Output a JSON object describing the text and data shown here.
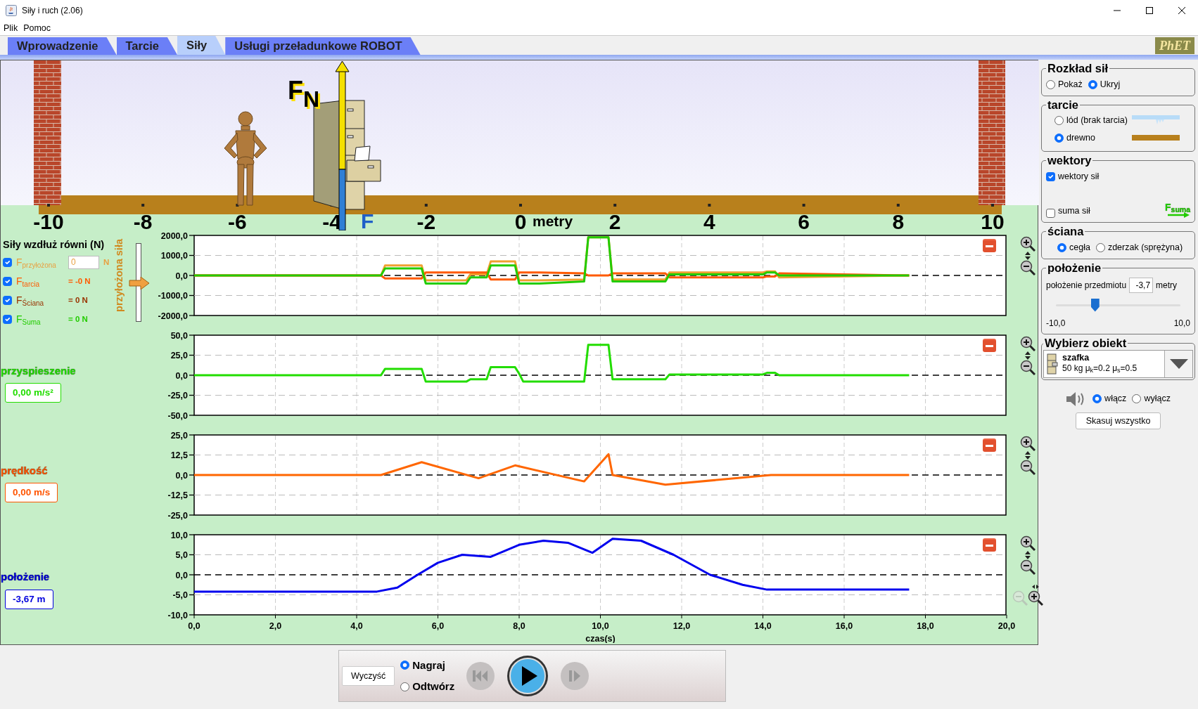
{
  "window": {
    "title": "Siły i ruch (2.06)"
  },
  "menu": [
    "Plik",
    "Pomoc"
  ],
  "tabs": [
    {
      "label": "Wprowadzenie",
      "selected": false
    },
    {
      "label": "Tarcie",
      "selected": false
    },
    {
      "label": "Siły",
      "selected": true
    },
    {
      "label": "Usługi przeładunkowe ROBOT",
      "selected": false
    }
  ],
  "logo": "PhET",
  "scene": {
    "ruler_labels": [
      "-10",
      "-8",
      "-6",
      "-4",
      "-2",
      "0",
      "2",
      "4",
      "6",
      "8",
      "10"
    ],
    "ruler_unit": "metry",
    "force_labels": [
      {
        "text": "F$_{N}$",
        "kind": "normal"
      },
      {
        "text": "F",
        "kind": "weight"
      }
    ]
  },
  "graphs": [
    {
      "kind": "forces",
      "title": "Siły wzdłuż równi (N)",
      "forces": [
        {
          "label": "F$_{przyłożona}$",
          "kind": "input",
          "value": "0",
          "unit": "N",
          "checked": true,
          "color": "#e8a040"
        },
        {
          "label": "F$_{tarcia}$",
          "kind": "reading",
          "reading": "= -0 N",
          "checked": true,
          "color": "#ff5a00"
        },
        {
          "label": "F$_{Ściana}$",
          "kind": "reading",
          "reading": "= 0 N",
          "checked": true,
          "color": "#993300"
        },
        {
          "label": "F$_{Suma}$",
          "kind": "reading",
          "reading": "= 0 N",
          "checked": true,
          "color": "#22cc00"
        }
      ],
      "slider": {
        "label": "przyłożona siła",
        "level": 0.5
      },
      "chart_data": {
        "type": "line",
        "x": [
          0,
          3.0,
          4.6,
          4.7,
          5.6,
          5.7,
          6.7,
          6.8,
          7.2,
          7.3,
          7.9,
          8.0,
          8.5,
          9.6,
          9.7,
          10.2,
          10.3,
          11.6,
          11.7,
          14.0,
          14.1,
          14.3,
          14.4,
          17.6
        ],
        "xlim": [
          0,
          20
        ],
        "ylim": [
          -2000,
          2000
        ],
        "grid": true,
        "ref_lines": [
          {
            "axis": "y",
            "value": 0
          }
        ],
        "yticks": [
          {
            "value": 2000,
            "label": "2000,0"
          },
          {
            "value": 1000,
            "label": "1000,0"
          },
          {
            "value": 0,
            "label": "0,0"
          },
          {
            "value": -1000,
            "label": "-1000,0"
          },
          {
            "value": -2000,
            "label": "-2000,0"
          }
        ],
        "series": [
          {
            "color": "#f0a030",
            "values": [
              0,
              0,
              0,
              500,
              500,
              -250,
              -250,
              50,
              50,
              700,
              700,
              -250,
              -250,
              -200,
              1900,
              1900,
              -200,
              -200,
              150,
              150,
              200,
              200,
              -100,
              0
            ]
          },
          {
            "color": "#ff5a00",
            "values": [
              0,
              0,
              0,
              -150,
              -150,
              150,
              150,
              150,
              150,
              -200,
              -200,
              150,
              150,
              100,
              0,
              0,
              100,
              100,
              -100,
              -100,
              -50,
              -50,
              100,
              0
            ]
          },
          {
            "color": "#22cc00",
            "values": [
              0,
              0,
              0,
              350,
              350,
              -400,
              -400,
              -100,
              -100,
              500,
              500,
              -400,
              -400,
              -300,
              1900,
              1900,
              -300,
              -300,
              50,
              50,
              150,
              150,
              0,
              0
            ]
          }
        ]
      }
    },
    {
      "kind": "motion",
      "title": "przyspieszenie",
      "readout": "0,00 m/s²",
      "color": "#22dd00",
      "chart_data": {
        "type": "line",
        "x": [
          0,
          4.6,
          4.7,
          5.6,
          5.7,
          6.7,
          6.8,
          7.2,
          7.3,
          7.9,
          8.0,
          8.1,
          9.6,
          9.7,
          10.2,
          10.3,
          11.6,
          11.7,
          14.0,
          14.1,
          14.3,
          14.4,
          17.6
        ],
        "xlim": [
          0,
          20
        ],
        "ylim": [
          -50,
          50
        ],
        "grid": true,
        "ref_lines": [
          {
            "axis": "y",
            "value": 0
          }
        ],
        "yticks": [
          {
            "value": 50,
            "label": "50,0"
          },
          {
            "value": 25,
            "label": "25,0"
          },
          {
            "value": 0,
            "label": "0,0"
          },
          {
            "value": -25,
            "label": "-25,0"
          },
          {
            "value": -50,
            "label": "-50,0"
          }
        ],
        "series": [
          {
            "color": "#22dd00",
            "values": [
              0,
              0,
              8,
              8,
              -8,
              -8,
              -5,
              -5,
              10,
              10,
              2,
              -8,
              -8,
              38,
              38,
              -5,
              -5,
              1,
              1,
              3,
              3,
              0,
              0
            ]
          }
        ]
      }
    },
    {
      "kind": "motion",
      "title": "prędkość",
      "readout": "0,00 m/s",
      "color": "#ff5500",
      "chart_data": {
        "type": "line",
        "x": [
          0,
          4.6,
          5.6,
          7.0,
          7.9,
          9.6,
          10.2,
          10.3,
          11.6,
          14.2,
          17.6
        ],
        "xlim": [
          0,
          20
        ],
        "ylim": [
          -25,
          25
        ],
        "grid": true,
        "ref_lines": [
          {
            "axis": "y",
            "value": 0
          }
        ],
        "yticks": [
          {
            "value": 25,
            "label": "25,0"
          },
          {
            "value": 12.5,
            "label": "12,5"
          },
          {
            "value": 0,
            "label": "0,0"
          },
          {
            "value": -12.5,
            "label": "-12,5"
          },
          {
            "value": -25,
            "label": "-25,0"
          }
        ],
        "series": [
          {
            "color": "#ff6600",
            "values": [
              0,
              0,
              8,
              -2,
              6,
              -4,
              13,
              0,
              -6,
              0,
              0
            ]
          }
        ]
      }
    },
    {
      "kind": "motion",
      "title": "położenie",
      "readout": "-3,67 m",
      "color": "#0000dd",
      "chart_data": {
        "type": "line",
        "x": [
          0,
          4.5,
          5.0,
          5.5,
          6.0,
          6.6,
          7.3,
          8.0,
          8.6,
          9.2,
          9.8,
          10.3,
          11.0,
          11.8,
          12.7,
          13.5,
          14.1,
          17.6
        ],
        "xlim": [
          0,
          20
        ],
        "ylim": [
          -10,
          10
        ],
        "grid": true,
        "ref_lines": [
          {
            "axis": "y",
            "value": 0
          }
        ],
        "xlabel": "czas(s)",
        "yticks": [
          {
            "value": 10,
            "label": "10,0"
          },
          {
            "value": 5,
            "label": "5,0"
          },
          {
            "value": 0,
            "label": "0,0"
          },
          {
            "value": -5,
            "label": "-5,0"
          },
          {
            "value": -10,
            "label": "-10,0"
          }
        ],
        "xticks": [
          {
            "value": 0,
            "label": "0,0"
          },
          {
            "value": 2,
            "label": "2,0"
          },
          {
            "value": 4,
            "label": "4,0"
          },
          {
            "value": 6,
            "label": "6,0"
          },
          {
            "value": 8,
            "label": "8,0"
          },
          {
            "value": 10,
            "label": "10,0"
          },
          {
            "value": 12,
            "label": "12,0"
          },
          {
            "value": 14,
            "label": "14,0"
          },
          {
            "value": 16,
            "label": "16,0"
          },
          {
            "value": 18,
            "label": "18,0"
          },
          {
            "value": 20,
            "label": "20,0"
          }
        ],
        "series": [
          {
            "color": "#0000ee",
            "values": [
              -4.2,
              -4.2,
              -3.2,
              0,
              3,
              5,
              4.5,
              7.5,
              8.5,
              8,
              5.5,
              9,
              8.5,
              5,
              0,
              -2.5,
              -3.7,
              -3.7
            ]
          }
        ]
      }
    }
  ],
  "force_display": {
    "title": "Rozkład sił",
    "options": [
      {
        "label": "Pokaż",
        "selected": false
      },
      {
        "label": "Ukryj",
        "selected": true
      }
    ]
  },
  "friction": {
    "title": "tarcie",
    "options": [
      {
        "label": "lód (brak tarcia)",
        "kind": "ice",
        "selected": false
      },
      {
        "label": "drewno",
        "kind": "wood",
        "selected": true
      }
    ]
  },
  "vectors": {
    "title": "wektory",
    "options": [
      {
        "label": "wektory sił",
        "checked": true
      },
      {
        "label": "suma sił",
        "checked": false
      }
    ],
    "legend": "F$_{suma}$"
  },
  "wall": {
    "title": "ściana",
    "options": [
      {
        "label": "cegła",
        "selected": true
      },
      {
        "label": "zderzak (sprężyna)",
        "selected": false
      }
    ]
  },
  "position": {
    "title": "położenie",
    "label": "położenie przedmiotu",
    "value": "-3,7",
    "unit": "metry",
    "level": 0.315,
    "min_label": "-10,0",
    "max_label": "10,0"
  },
  "object": {
    "title": "Wybierz obiekt",
    "name": "szafka",
    "details": "50 kg μ$_{k}$=0.2 μ$_{s}$=0.5"
  },
  "sound": {
    "options": [
      {
        "label": "włącz",
        "selected": true
      },
      {
        "label": "wyłącz",
        "selected": false
      }
    ]
  },
  "reset_button": "Skasuj wszystko",
  "playback": {
    "clear_button": "Wyczyść",
    "modes": [
      {
        "label": "Nagraj",
        "selected": true
      },
      {
        "label": "Odtwórz",
        "selected": false
      }
    ],
    "buttons": [
      {
        "kind": "rewind",
        "disabled": true
      },
      {
        "kind": "play",
        "disabled": false
      },
      {
        "kind": "step",
        "disabled": true
      }
    ]
  }
}
